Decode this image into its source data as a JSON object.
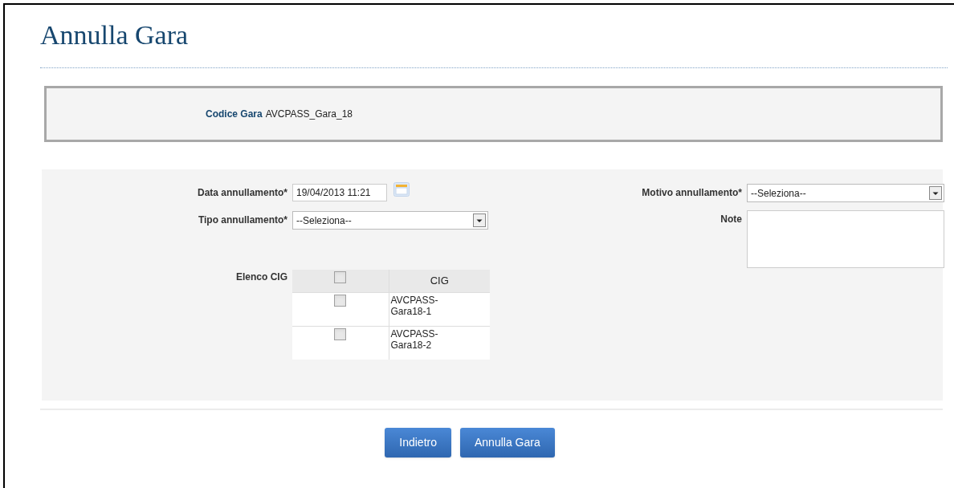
{
  "title": "Annulla Gara",
  "info": {
    "label": "Codice Gara",
    "value": "AVCPASS_Gara_18"
  },
  "left_fields": [
    {
      "kind": "date",
      "label": "Data annullamento*",
      "value": "19/04/2013 11:21"
    },
    {
      "kind": "select",
      "label": "Tipo annullamento*",
      "value": "--Seleziona--"
    }
  ],
  "right_fields": [
    {
      "kind": "select",
      "label": "Motivo annullamento*",
      "value": "--Seleziona--"
    },
    {
      "kind": "textarea",
      "label": "Note"
    }
  ],
  "cig_table": {
    "label": "Elenco CIG",
    "header_checked": false,
    "column": "CIG",
    "rows": [
      {
        "checked": false,
        "cig": "AVCPASS-\nGara18-1"
      },
      {
        "checked": false,
        "cig": "AVCPASS-\nGara18-2"
      }
    ]
  },
  "buttons": [
    "Indietro",
    "Annulla Gara"
  ]
}
